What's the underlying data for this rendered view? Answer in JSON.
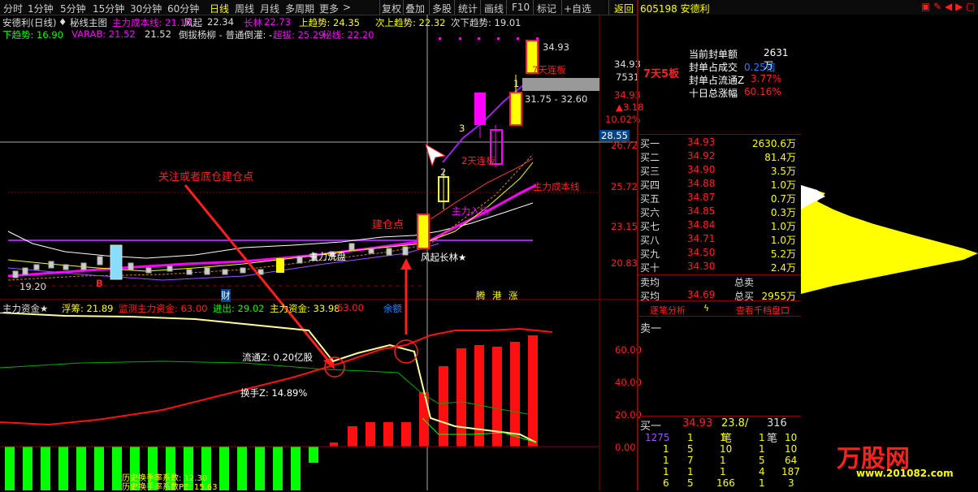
{
  "toolbar": {
    "period_tabs": [
      "分时",
      "1分钟",
      "5分钟",
      "15分钟",
      "30分钟",
      "60分钟",
      "日线",
      "周线",
      "月线",
      "多周期",
      "更多"
    ],
    "buttons": [
      "复权",
      "叠加",
      "多股",
      "统计",
      "画线",
      "F10",
      "标记",
      "+自选",
      "返回"
    ]
  },
  "chart_header": {
    "stock": "安德利(日线)",
    "main_chart": "秘线主图",
    "main_cost": "主力成本线: 21.16",
    "fengqi_label": "风起",
    "fengqi_value": "22.34",
    "changlin_label": "长林",
    "changlin_value": "22.73",
    "up_trend": "上趋势: 24.35",
    "next_up_trend": "次上趋势: 22.32",
    "next_down_trend": "次下趋势: 19.01",
    "down_trend": "下趋势: 16.90",
    "varab_label": "VARAB: 21.52",
    "varab_value": "21.52",
    "daobao": "倒拔杨柳 - 普通倒灌: -",
    "chaobao": "超拔: 25.29",
    "mixian": "秘线: 22.20"
  },
  "chart_labels": {
    "price_3493_top": "34.93",
    "price_3493_right": "34.93",
    "vol_7531": "7531",
    "price_3493_b": "34.93",
    "up_318": "▲3.18",
    "pct_1002": "10.02%",
    "cur_2855": "28.55",
    "price_2672": "26.72",
    "price_2572": "25.72",
    "price_2315": "23.15",
    "price_2083": "20.83",
    "range": "31.75 - 32.60",
    "marker_1": "1",
    "marker_2": "2",
    "marker_3": "3",
    "lianban_7": "7天连板",
    "lianban_2": "2天连板",
    "main_cost_line": "主力成本线",
    "main_enter": "主力入场",
    "main_exit": "主力洗盘",
    "fengqi_changlin": "风起长林★",
    "build_pos": "建仓点",
    "annotation_watch": "关注或者底仓建仓点",
    "low_price": "19.20",
    "cai": "财",
    "teng": "腾",
    "gang": "港",
    "zhang": "涨",
    "b_marker": "B"
  },
  "sub_header": {
    "title": "主力资金★",
    "fuchou": "浮筹: 21.89",
    "jiance": "监测主力资金: 63.00",
    "jinchu": "进出: 29.02",
    "zhuli": "主力资金: 33.98",
    "val_6300": "63.00",
    "shengyu": "余额"
  },
  "sub_labels": {
    "liutong": "流通Z: 0.20亿股",
    "huanshou": "换手Z: 14.89%",
    "axis_60": "60.00",
    "axis_40": "40.00",
    "axis_20": "20.00",
    "axis_0": "0.00",
    "bottom1": "历史换手率系数: 12.30",
    "bottom2": "历史换手率系数PE: 15.63"
  },
  "right_panel": {
    "code_name": "605198 安德利",
    "board": "7天5板",
    "stats": [
      {
        "label": "当前封单额",
        "value": "2631万"
      },
      {
        "label": "封单占成交",
        "value": "0.25倍"
      },
      {
        "label": "封单占流通Z",
        "value": "3.77%"
      },
      {
        "label": "十日总涨幅",
        "value": "60.16%"
      }
    ],
    "bids": [
      {
        "label": "买一",
        "price": "34.93",
        "vol": "2630.6万"
      },
      {
        "label": "买二",
        "price": "34.92",
        "vol": "81.4万"
      },
      {
        "label": "买三",
        "price": "34.90",
        "vol": "3.5万"
      },
      {
        "label": "买四",
        "price": "34.88",
        "vol": "1.0万"
      },
      {
        "label": "买五",
        "price": "34.87",
        "vol": "0.7万"
      },
      {
        "label": "买六",
        "price": "34.85",
        "vol": "0.3万"
      },
      {
        "label": "买七",
        "price": "34.84",
        "vol": "1.0万"
      },
      {
        "label": "买八",
        "price": "34.71",
        "vol": "1.0万"
      },
      {
        "label": "买九",
        "price": "34.50",
        "vol": "5.2万"
      },
      {
        "label": "买十",
        "price": "34.30",
        "vol": "2.4万"
      }
    ],
    "avg_sell_label": "卖均",
    "avg_sell_total": "总卖",
    "avg_buy_label": "买均",
    "avg_buy_price": "34.69",
    "avg_buy_total_label": "总买",
    "avg_buy_total": "2955万",
    "tools": [
      "逐笔分析",
      "查看千档盘口"
    ],
    "sell_one": "卖一",
    "buy_one_label": "买一",
    "buy_one_price": "34.93",
    "buy_one_avg": "23.8/笔",
    "buy_one_count": "316笔",
    "queue": [
      [
        "1275",
        "1",
        "1",
        "1",
        "10"
      ],
      [
        "1",
        "5",
        "10",
        "1",
        "10"
      ],
      [
        "1",
        "7",
        "1",
        "5",
        "64"
      ],
      [
        "1",
        "1",
        "1",
        "4",
        "187"
      ],
      [
        "6",
        "5",
        "166",
        "1",
        "3"
      ]
    ],
    "watermark_text": "万股网",
    "watermark_url": "www.201082.com"
  },
  "colors": {
    "grid": "#8b0000",
    "up": "#ff2020",
    "yellow": "#ffff00",
    "green": "#00ff00",
    "magenta": "#ff00ff",
    "cyan": "#00ffff"
  }
}
